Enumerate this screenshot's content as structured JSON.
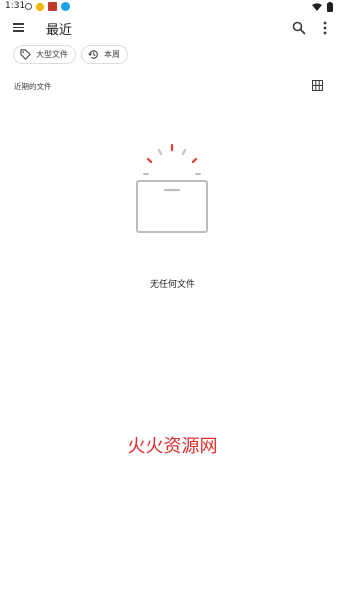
{
  "status_bar": {
    "time": "1:31",
    "icons": [
      "alarm-icon",
      "weather-sun-icon",
      "app-notification-icon",
      "blue-app-icon",
      "wifi-icon",
      "battery-icon"
    ]
  },
  "app_bar": {
    "title": "最近",
    "menu_icon": "hamburger-menu-icon",
    "search_icon": "search-icon",
    "more_icon": "more-vert-icon"
  },
  "filters": [
    {
      "label": "大型文件",
      "icon": "tag-icon"
    },
    {
      "label": "本周",
      "icon": "history-icon"
    }
  ],
  "section": {
    "label": "近期的文件",
    "view_toggle_icon": "grid-view-icon"
  },
  "empty_state": {
    "text": "无任何文件",
    "accent_color": "#e53935"
  },
  "watermark": {
    "text": "火火资源网",
    "color": "#e02d2d"
  }
}
